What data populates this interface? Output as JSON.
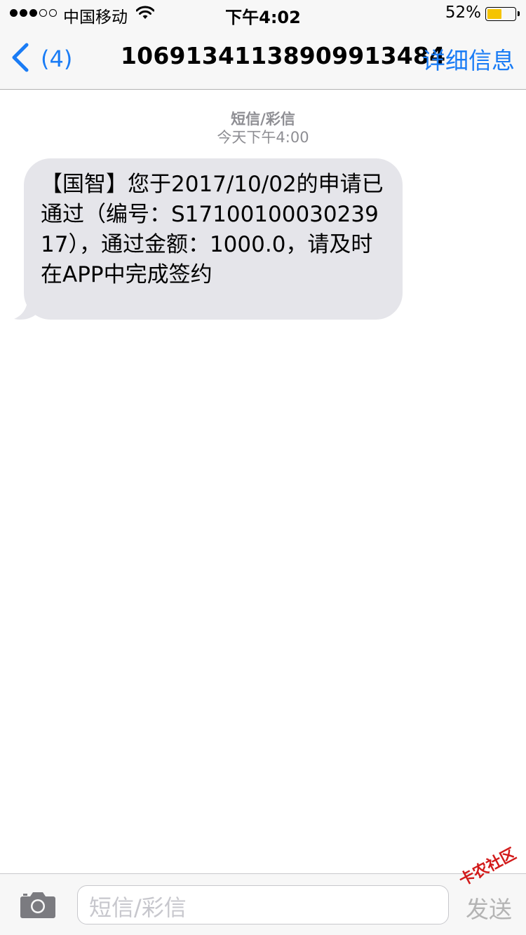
{
  "status_bar": {
    "carrier": "中国移动",
    "time": "下午4:02",
    "battery_percent": "52%",
    "battery_level": 0.52,
    "signal_bars_filled": 3,
    "signal_bars_total": 5,
    "battery_color": "#f5c400"
  },
  "nav": {
    "back_count": "(4)",
    "title": "106913411389099134 84",
    "details_label": "详细信息",
    "accent_color": "#1a7cf5"
  },
  "conversation": {
    "message_type": "短信/彩信",
    "timestamp": "今天下午4:00",
    "messages": [
      {
        "direction": "incoming",
        "text": "【国智】您于2017/10/02的申请已通过（编号：S1710010003023917），通过金额：1000.0，请及时在APP中完成签约"
      }
    ]
  },
  "input_bar": {
    "placeholder": "短信/彩信",
    "send_label": "发送",
    "camera_icon": "camera-icon"
  },
  "watermark": {
    "text": "卡农社区"
  }
}
